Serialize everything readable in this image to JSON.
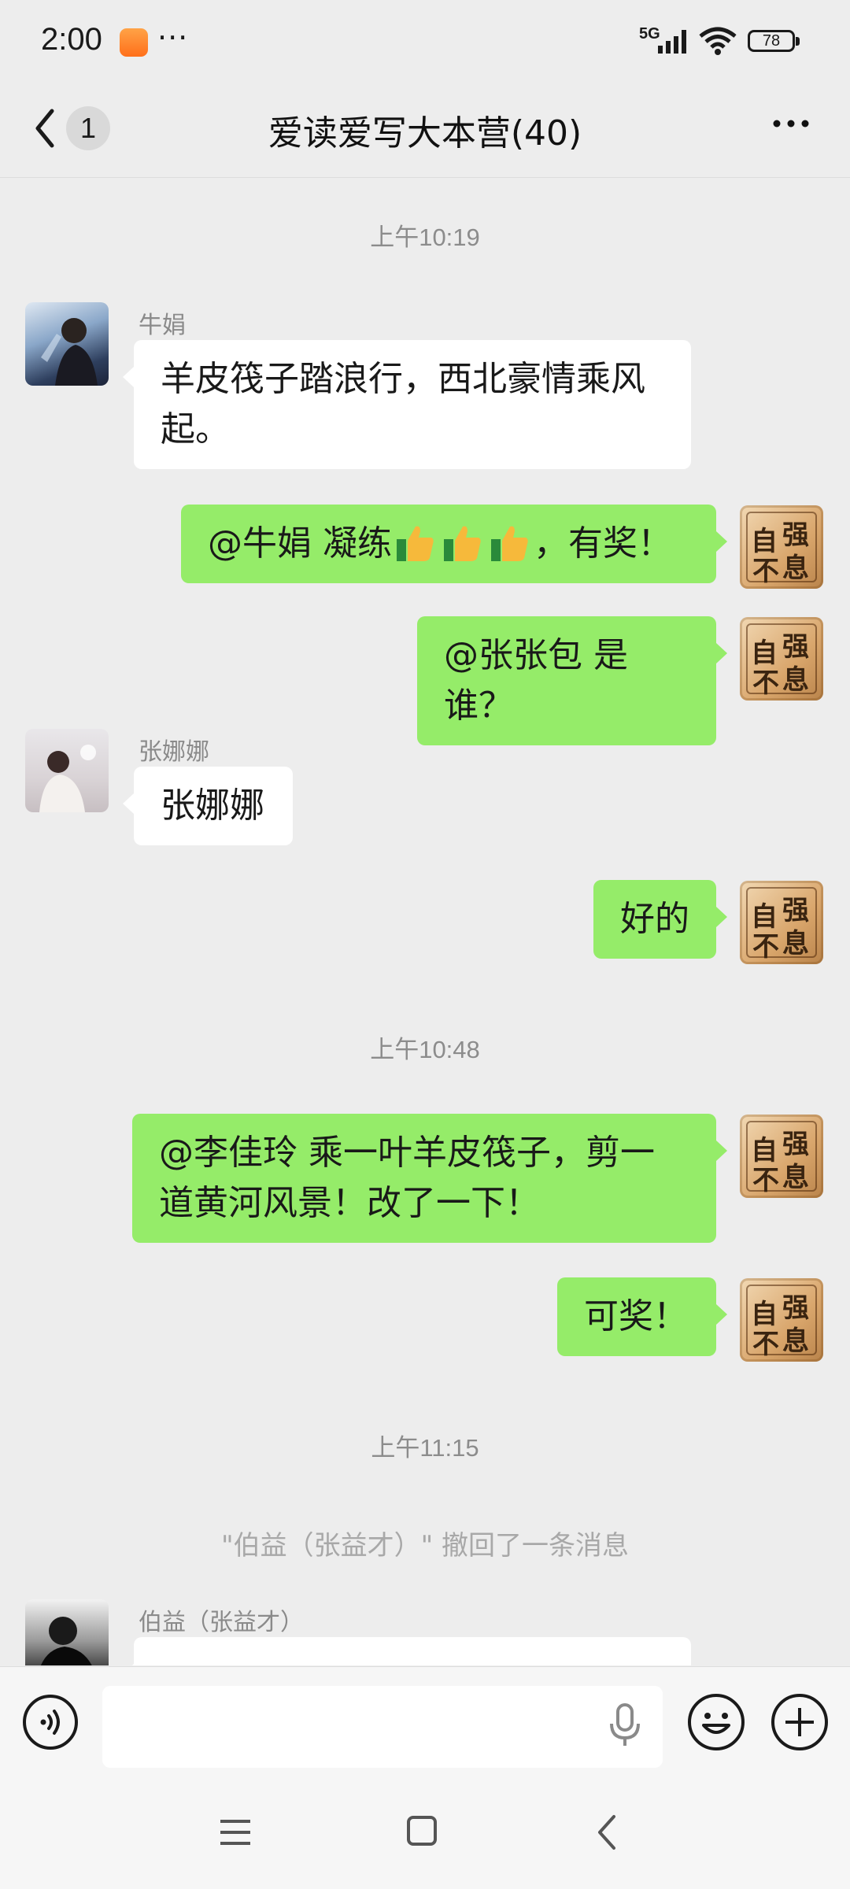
{
  "status_bar": {
    "time": "2:00",
    "dots": "···",
    "network": "5G",
    "battery": "78"
  },
  "title_bar": {
    "unread_count": "1",
    "title": "爱读爱写大本营(40)"
  },
  "chat": {
    "timestamps": [
      "上午10:19",
      "上午10:48",
      "上午11:15"
    ],
    "recall_notice": "\"伯益（张益才）\" 撤回了一条消息",
    "messages": [
      {
        "side": "left",
        "sender": "牛娟",
        "lines": [
          "羊皮筏子踏浪行，西北豪情乘风",
          "起。"
        ]
      },
      {
        "side": "right",
        "text_before": "@牛娟  凝练",
        "emoji": "thumbs-up",
        "emoji_count": 3,
        "text_after": "，有奖！"
      },
      {
        "side": "right",
        "text": "@张张包  是谁？"
      },
      {
        "side": "left",
        "sender": "张娜娜",
        "text": "张娜娜"
      },
      {
        "side": "right",
        "text": "好的"
      },
      {
        "side": "right",
        "lines": [
          "@李佳玲  乘一叶羊皮筏子，剪一",
          "道黄河风景！改了一下！"
        ]
      },
      {
        "side": "right",
        "text": "可奖！"
      },
      {
        "side": "left",
        "sender": "伯益（张益才）",
        "text": "（partially hidden）"
      }
    ],
    "seal_chars": [
      "自",
      "强",
      "不",
      "息"
    ]
  },
  "input": {
    "placeholder": ""
  }
}
